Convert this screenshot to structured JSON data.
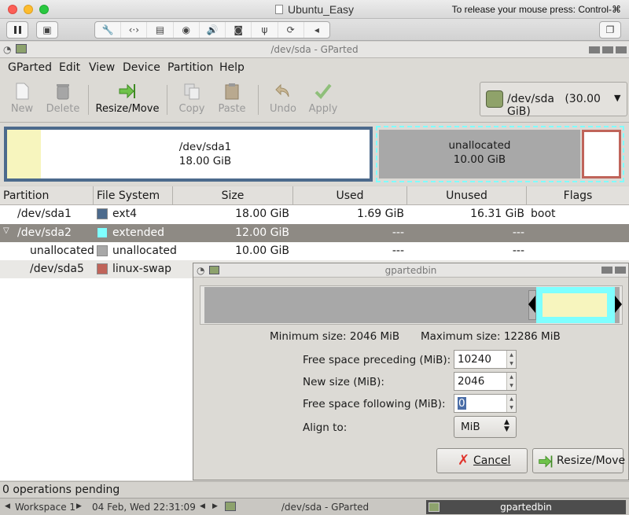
{
  "mac": {
    "title": "Ubuntu_Easy",
    "release_hint": "To release your mouse press: Control-⌘",
    "toolbar_icons": [
      "wrench-icon",
      "network-icon",
      "hard-disk-icon",
      "disc-icon",
      "speaker-icon",
      "camera-icon",
      "usb-icon",
      "refresh-icon",
      "chevron-left-icon"
    ]
  },
  "window": {
    "title": "/dev/sda - GParted"
  },
  "menu": [
    "GParted",
    "Edit",
    "View",
    "Device",
    "Partition",
    "Help"
  ],
  "toolbar": {
    "new": "New",
    "delete": "Delete",
    "resize": "Resize/Move",
    "copy": "Copy",
    "paste": "Paste",
    "undo": "Undo",
    "apply": "Apply"
  },
  "device": {
    "name": "/dev/sda",
    "size": "(30.00 GiB)"
  },
  "disk_map": {
    "sda1": {
      "name": "/dev/sda1",
      "size": "18.00 GiB"
    },
    "unalloc": {
      "name": "unallocated",
      "size": "10.00 GiB"
    }
  },
  "table": {
    "headers": [
      "Partition",
      "File System",
      "Size",
      "Used",
      "Unused",
      "Flags"
    ],
    "rows": [
      {
        "partition": "/dev/sda1",
        "fs": "ext4",
        "fs_color": "#4c6a8c",
        "size": "18.00 GiB",
        "used": "1.69 GiB",
        "unused": "16.31 GiB",
        "flags": "boot"
      },
      {
        "partition": "/dev/sda2",
        "fs": "extended",
        "fs_color": "#7fffff",
        "size": "12.00 GiB",
        "used": "---",
        "unused": "---",
        "flags": ""
      },
      {
        "partition": "unallocated",
        "fs": "unallocated",
        "fs_color": "#a8a8a8",
        "size": "10.00 GiB",
        "used": "---",
        "unused": "---",
        "flags": ""
      },
      {
        "partition": "/dev/sda5",
        "fs": "linux-swap",
        "fs_color": "#c0645a",
        "size": "",
        "used": "",
        "unused": "",
        "flags": ""
      }
    ]
  },
  "status": "0 operations pending",
  "taskbar": {
    "workspace": "Workspace 1",
    "datetime": "04 Feb, Wed 22:31:09",
    "task1": "/dev/sda - GParted",
    "task2": "gpartedbin"
  },
  "dialog": {
    "title": "gpartedbin",
    "min_size": "Minimum size: 2046 MiB",
    "max_size": "Maximum size: 12286 MiB",
    "free_preceding_label": "Free space preceding (MiB):",
    "free_preceding_value": "10240",
    "new_size_label": "New size (MiB):",
    "new_size_value": "2046",
    "free_following_label": "Free space following (MiB):",
    "free_following_value": "0",
    "align_label": "Align to:",
    "align_value": "MiB",
    "cancel": "Cancel",
    "resize": "Resize/Move"
  }
}
